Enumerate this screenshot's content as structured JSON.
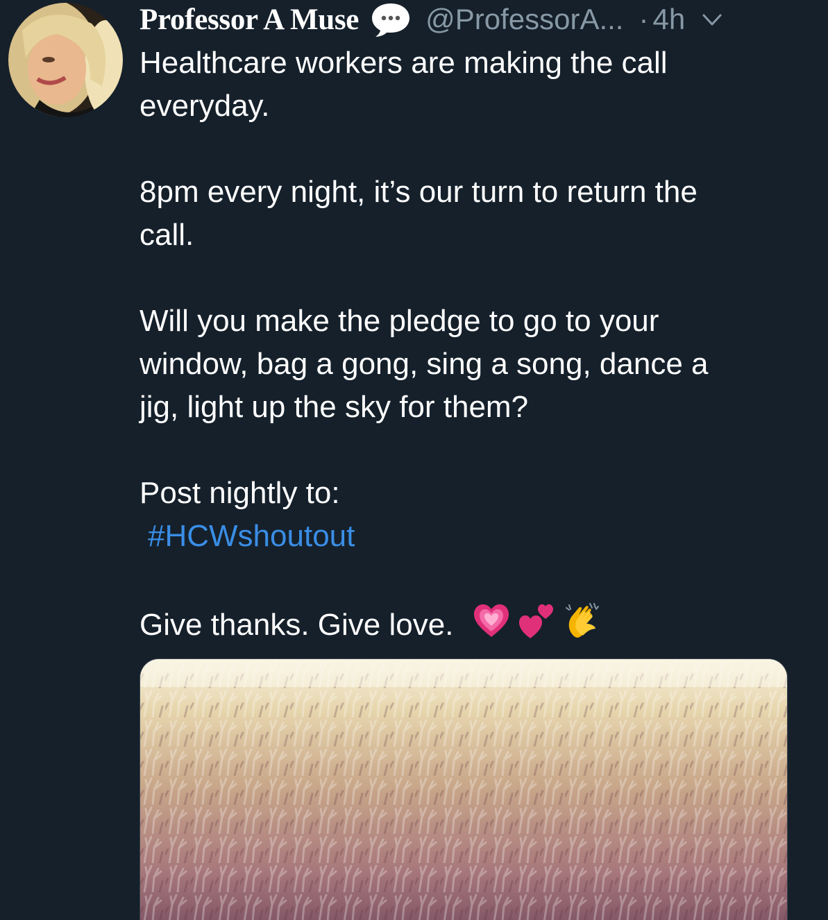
{
  "tweet": {
    "display_name": "Professor A Muse",
    "handle": "@ProfessorA...",
    "separator": "·",
    "timestamp": "4h",
    "lines": [
      "Healthcare workers are making the call",
      "everyday.",
      "8pm every night, it’s our turn to return the",
      "call.",
      "Will you make the pledge to go to your",
      "window, bag a gong, sing a song, dance a",
      "jig, light up the sky for them?",
      "Post nightly to:"
    ],
    "hashtag": "#HCWshoutout",
    "closing": "Give thanks. Give love.",
    "emojis": [
      "sparkling-heart-icon",
      "two-hearts-icon",
      "clapping-hands-icon"
    ]
  },
  "icons": {
    "name_badge": "speech-bubble-icon",
    "menu": "chevron-down-icon"
  },
  "colors": {
    "background": "#15202b",
    "text": "#ffffff",
    "secondary": "#8899a6",
    "link": "#3a8ee6"
  }
}
